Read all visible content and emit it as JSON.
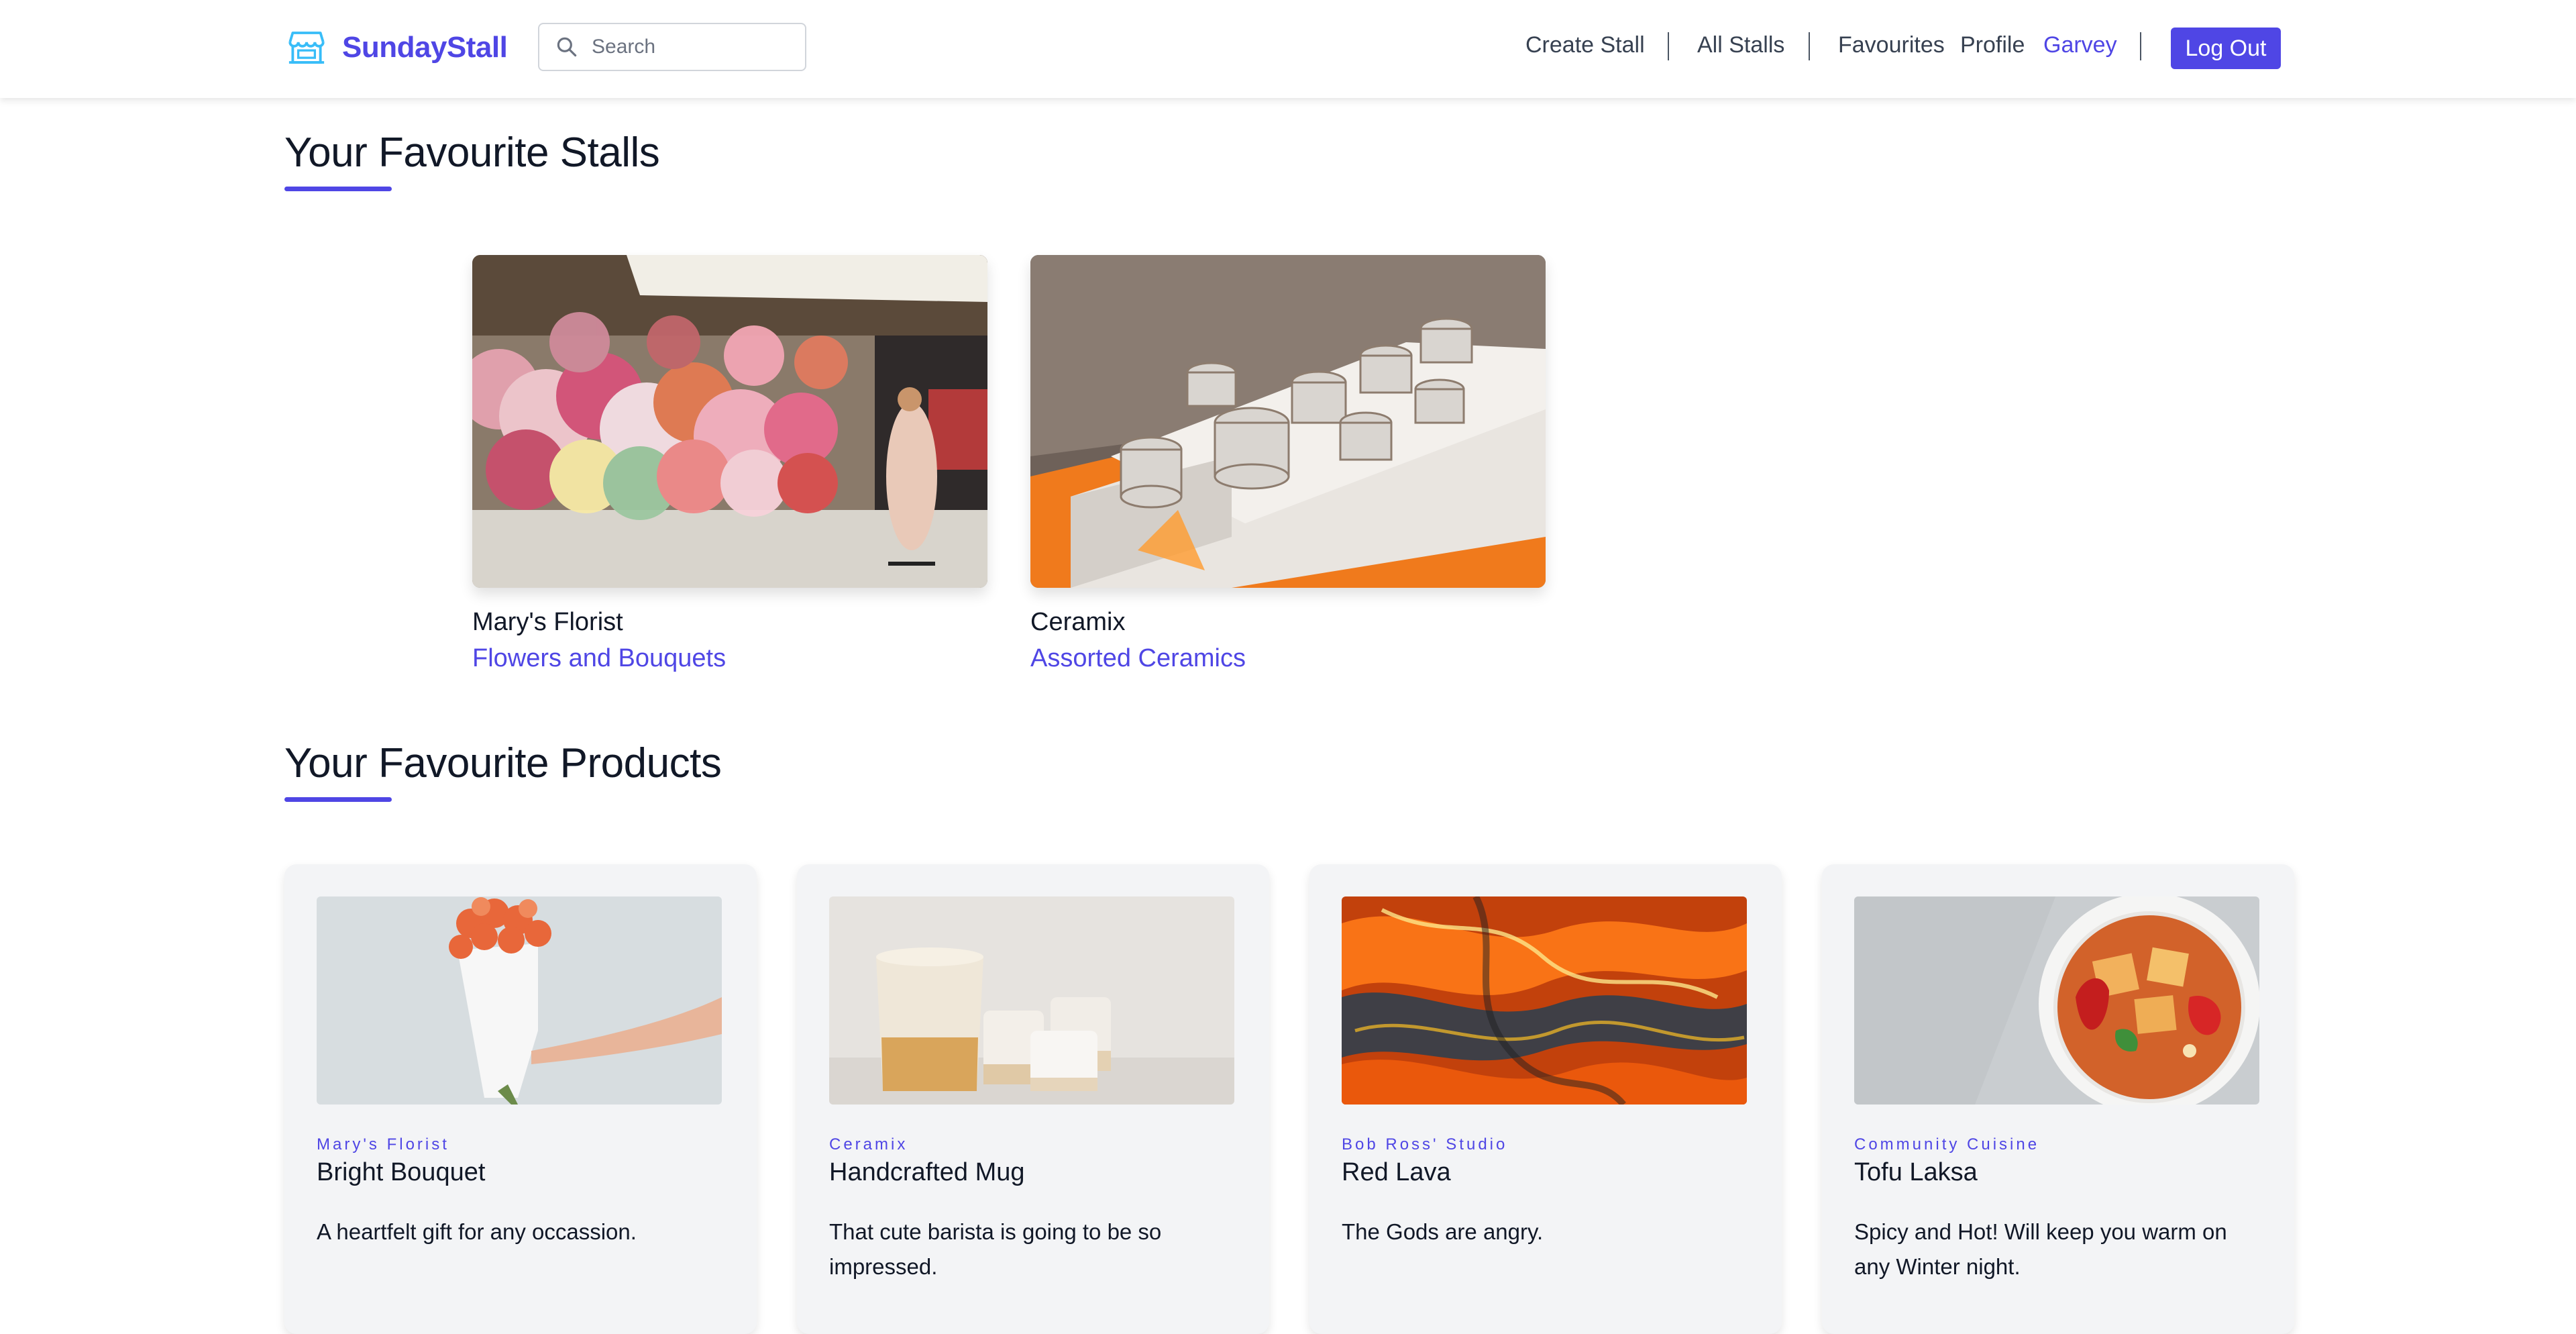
{
  "brand": {
    "name": "SundayStall",
    "icon": "storefront-icon"
  },
  "search": {
    "placeholder": "Search",
    "value": ""
  },
  "nav": {
    "create_stall": "Create Stall",
    "all_stalls": "All Stalls",
    "favourites": "Favourites",
    "profile": "Profile",
    "username": "Garvey",
    "logout": "Log Out"
  },
  "colors": {
    "accent": "#4f46e5",
    "card_bg": "#f3f4f6"
  },
  "stalls_section": {
    "title": "Your Favourite Stalls"
  },
  "stalls": [
    {
      "name": "Mary's Florist",
      "category": "Flowers and Bouquets",
      "image": "flower-market-photo"
    },
    {
      "name": "Ceramix",
      "category": "Assorted Ceramics",
      "image": "kiln-cups-photo"
    }
  ],
  "products_section": {
    "title": "Your Favourite Products"
  },
  "products": [
    {
      "stall": "Mary's Florist",
      "name": "Bright Bouquet",
      "description": "A heartfelt gift for any occassion.",
      "image": "bouquet-photo"
    },
    {
      "stall": "Ceramix",
      "name": "Handcrafted Mug",
      "description": "That cute barista is going to be so impressed.",
      "image": "mugs-photo"
    },
    {
      "stall": "Bob Ross' Studio",
      "name": "Red Lava",
      "description": "The Gods are angry.",
      "image": "lava-painting-photo"
    },
    {
      "stall": "Community Cuisine",
      "name": "Tofu Laksa",
      "description": "Spicy and Hot! Will keep you warm on any Winter night.",
      "image": "laksa-bowl-photo"
    }
  ]
}
